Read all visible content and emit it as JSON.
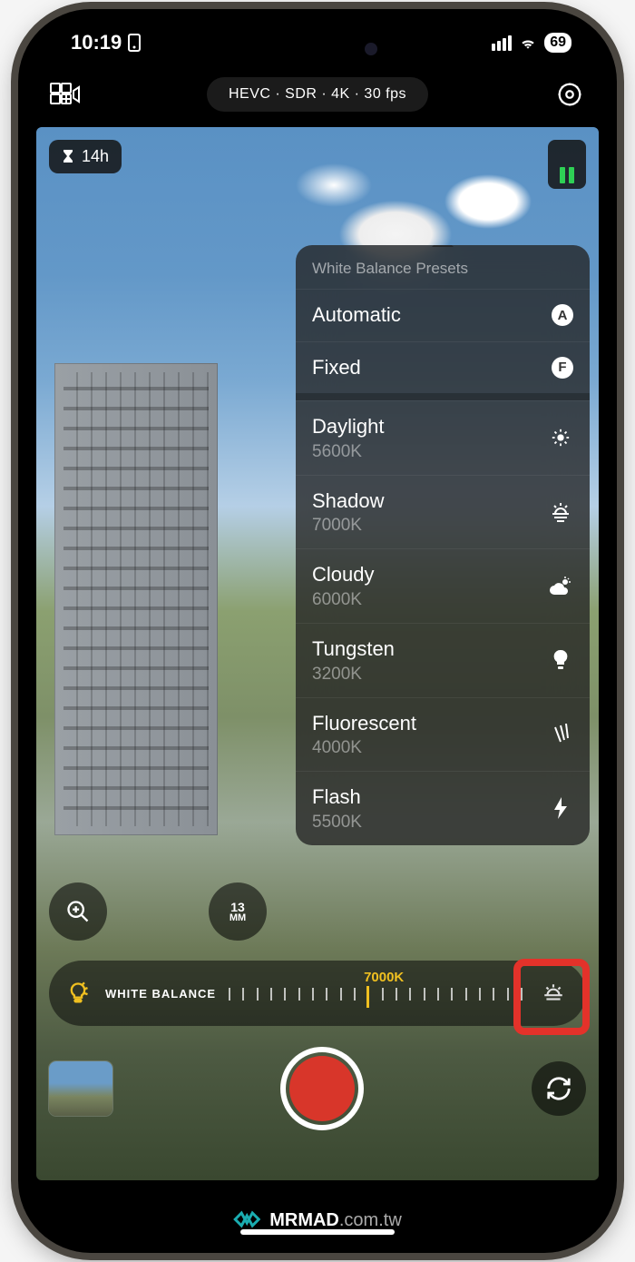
{
  "status": {
    "time": "10:19",
    "battery": "69"
  },
  "toolbar": {
    "format": "HEVC · SDR · 4K · 30 fps"
  },
  "storage": {
    "remaining": "14h"
  },
  "focal": {
    "mm": "13",
    "unit": "MM"
  },
  "wb_popup": {
    "title": "White Balance Presets",
    "automatic": "Automatic",
    "fixed": "Fixed",
    "auto_badge": "A",
    "fixed_badge": "F",
    "items": [
      {
        "label": "Daylight",
        "sub": "5600K",
        "icon": "sun"
      },
      {
        "label": "Shadow",
        "sub": "7000K",
        "icon": "sunset"
      },
      {
        "label": "Cloudy",
        "sub": "6000K",
        "icon": "cloud-sun"
      },
      {
        "label": "Tungsten",
        "sub": "3200K",
        "icon": "bulb"
      },
      {
        "label": "Fluorescent",
        "sub": "4000K",
        "icon": "fluorescent"
      },
      {
        "label": "Flash",
        "sub": "5500K",
        "icon": "flash"
      }
    ]
  },
  "wb_bar": {
    "label": "WHITE BALANCE",
    "value": "7000K"
  },
  "watermark": {
    "brand": "MRMAD",
    "domain": ".com.tw"
  }
}
